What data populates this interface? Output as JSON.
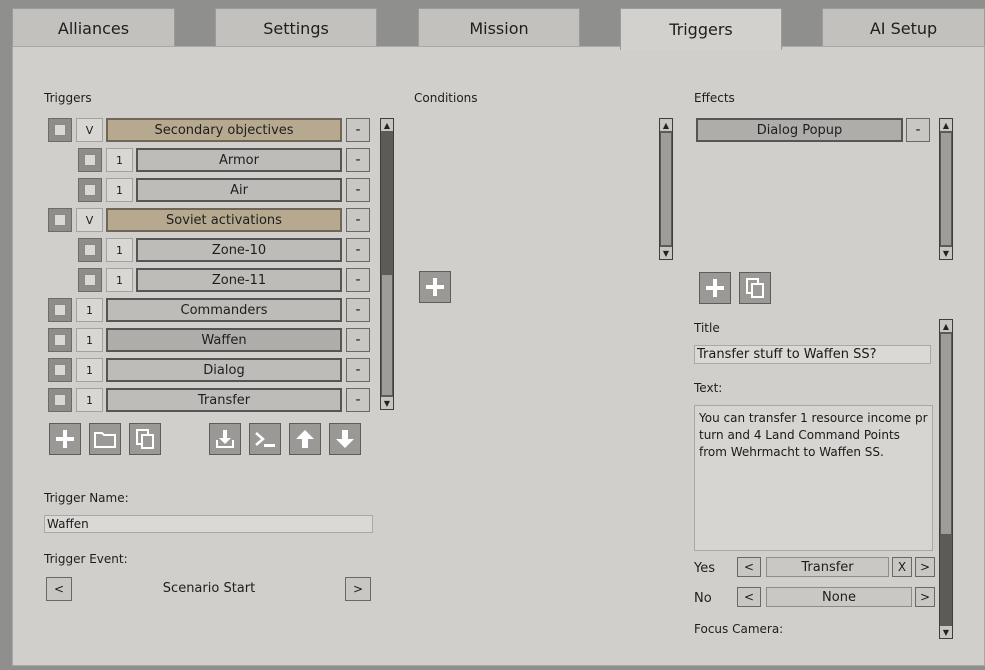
{
  "tabs": [
    {
      "label": "Alliances"
    },
    {
      "label": "Settings"
    },
    {
      "label": "Mission"
    },
    {
      "label": "Triggers"
    },
    {
      "label": "AI Setup"
    }
  ],
  "triggers": {
    "label": "Triggers",
    "items": [
      {
        "num": "V",
        "label": "Secondary objectives",
        "type": "group",
        "indent": false,
        "minus": "-"
      },
      {
        "num": "1",
        "label": "Armor",
        "type": "item",
        "indent": true,
        "minus": "-"
      },
      {
        "num": "1",
        "label": "Air",
        "type": "item",
        "indent": true,
        "minus": "-"
      },
      {
        "num": "V",
        "label": "Soviet activations",
        "type": "group",
        "indent": false,
        "minus": "-"
      },
      {
        "num": "1",
        "label": "Zone-10",
        "type": "item",
        "indent": true,
        "minus": "-"
      },
      {
        "num": "1",
        "label": "Zone-11",
        "type": "item",
        "indent": true,
        "minus": "-"
      },
      {
        "num": "1",
        "label": "Commanders",
        "type": "item",
        "indent": false,
        "minus": "-"
      },
      {
        "num": "1",
        "label": "Waffen",
        "type": "selected",
        "indent": false,
        "minus": "-"
      },
      {
        "num": "1",
        "label": "Dialog",
        "type": "item",
        "indent": false,
        "minus": "-"
      },
      {
        "num": "1",
        "label": "Transfer",
        "type": "item",
        "indent": false,
        "minus": "-"
      }
    ],
    "name_label": "Trigger Name:",
    "name_value": "Waffen",
    "event_label": "Trigger Event:",
    "event_value": "Scenario Start",
    "prev": "<",
    "next": ">"
  },
  "conditions": {
    "label": "Conditions"
  },
  "effects": {
    "label": "Effects",
    "items": [
      {
        "label": "Dialog Popup",
        "minus": "-"
      }
    ],
    "title_label": "Title",
    "title_value": "Transfer stuff to Waffen SS?",
    "text_label": "Text:",
    "text_value": "You can transfer 1 resource income pr turn and 4 Land Command Points from Wehrmacht to Waffen SS.",
    "yes_label": "Yes",
    "yes_value": "Transfer",
    "yes_clear": "X",
    "no_label": "No",
    "no_value": "None",
    "focus_label": "Focus Camera:",
    "prev": "<",
    "next": ">"
  },
  "icons": {
    "add": "plus-icon",
    "folder": "folder-icon",
    "copy": "copy-icon",
    "import": "download-icon",
    "console": "console-icon",
    "up": "arrow-up-icon",
    "down": "arrow-down-icon"
  }
}
